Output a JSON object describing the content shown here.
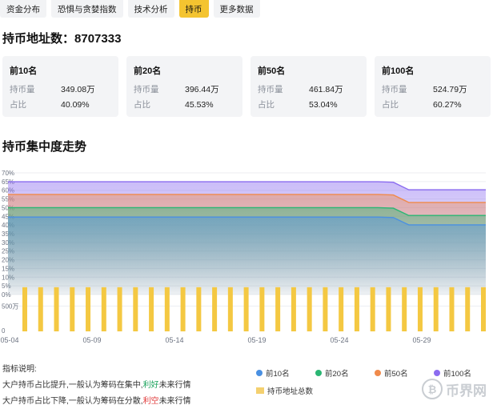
{
  "tabs": [
    {
      "label": "资金分布",
      "active": false
    },
    {
      "label": "恐惧与贪婪指数",
      "active": false
    },
    {
      "label": "技术分析",
      "active": false
    },
    {
      "label": "持币",
      "active": true
    },
    {
      "label": "更多数据",
      "active": false
    }
  ],
  "address_count": {
    "label": "持币地址数：",
    "value": "8707333"
  },
  "cards": [
    {
      "title": "前10名",
      "qty_label": "持币量",
      "qty": "349.08万",
      "ratio_label": "占比",
      "ratio": "40.09%"
    },
    {
      "title": "前20名",
      "qty_label": "持币量",
      "qty": "396.44万",
      "ratio_label": "占比",
      "ratio": "45.53%"
    },
    {
      "title": "前50名",
      "qty_label": "持币量",
      "qty": "461.84万",
      "ratio_label": "占比",
      "ratio": "53.04%"
    },
    {
      "title": "前100名",
      "qty_label": "持币量",
      "qty": "524.79万",
      "ratio_label": "占比",
      "ratio": "60.27%"
    }
  ],
  "chart_section_title": "持币集中度走势",
  "chart_data": {
    "type": "area",
    "y_ticks": [
      "70%",
      "65%",
      "60%",
      "55%",
      "50%",
      "45%",
      "40%",
      "35%",
      "30%",
      "25%",
      "20%",
      "15%",
      "10%",
      "5%",
      "0%"
    ],
    "ylim": [
      0,
      70
    ],
    "x_tick_labels": [
      "05-04",
      "05-09",
      "05-14",
      "05-19",
      "05-24",
      "05-29"
    ],
    "series": [
      {
        "name": "前100名",
        "color": "#8b6cf0",
        "values": [
          64.9,
          64.9,
          64.9,
          64.9,
          64.9,
          64.9,
          64.9,
          64.9,
          64.9,
          64.9,
          64.9,
          64.9,
          64.9,
          64.9,
          64.9,
          64.9,
          64.9,
          64.9,
          64.9,
          64.9,
          64.9,
          64.9,
          64.9,
          64.9,
          64.9,
          64.6,
          60.3,
          60.3,
          60.3,
          60.3,
          60.3,
          60.3
        ]
      },
      {
        "name": "前50名",
        "color": "#f08a4b",
        "values": [
          57.6,
          57.6,
          57.6,
          57.6,
          57.6,
          57.6,
          57.6,
          57.6,
          57.6,
          57.6,
          57.6,
          57.6,
          57.6,
          57.6,
          57.6,
          57.6,
          57.6,
          57.6,
          57.6,
          57.6,
          57.6,
          57.6,
          57.6,
          57.6,
          57.6,
          57.3,
          53.0,
          53.0,
          53.0,
          53.0,
          53.0,
          53.0
        ]
      },
      {
        "name": "前20名",
        "color": "#2bb673",
        "values": [
          50.0,
          50.0,
          50.0,
          50.0,
          50.0,
          50.0,
          50.0,
          50.0,
          50.0,
          50.0,
          50.0,
          50.0,
          50.0,
          50.0,
          50.0,
          50.0,
          50.0,
          50.0,
          50.0,
          50.0,
          50.0,
          50.0,
          50.0,
          50.0,
          50.0,
          49.7,
          45.5,
          45.5,
          45.5,
          45.5,
          45.5,
          45.5
        ]
      },
      {
        "name": "前10名",
        "color": "#4a90e2",
        "values": [
          44.6,
          44.6,
          44.6,
          44.6,
          44.6,
          44.6,
          44.6,
          44.6,
          44.6,
          44.6,
          44.6,
          44.6,
          44.6,
          44.6,
          44.6,
          44.6,
          44.6,
          44.6,
          44.6,
          44.6,
          44.6,
          44.6,
          44.6,
          44.6,
          44.6,
          44.3,
          40.1,
          40.1,
          40.1,
          40.1,
          40.1,
          40.1
        ]
      }
    ],
    "bar_series": {
      "name": "持币地址总数",
      "color": "#f4c842",
      "tick_label": "500万",
      "tick_value": 5000000,
      "ylim": [
        0,
        6000000
      ],
      "bar_count": 30,
      "value": 8707333
    }
  },
  "legend_desc": {
    "title": "指标说明:",
    "line1_prefix": "大户持币占比提升,一般认为筹码在集中,",
    "line1_highlight": "利好",
    "line1_suffix": "未来行情",
    "line2_prefix": "大户持币占比下降,一般认为筹码在分散,",
    "line2_highlight": "利空",
    "line2_suffix": "未来行情"
  },
  "legend": {
    "items": [
      {
        "label": "前10名",
        "color": "#4a90e2"
      },
      {
        "label": "前20名",
        "color": "#2bb673"
      },
      {
        "label": "前50名",
        "color": "#f08a4b"
      },
      {
        "label": "前100名",
        "color": "#8b6cf0"
      }
    ],
    "bar_label": "持币地址总数"
  },
  "watermark": {
    "text": "币界网",
    "icon": "bitcoin-logo-icon"
  }
}
